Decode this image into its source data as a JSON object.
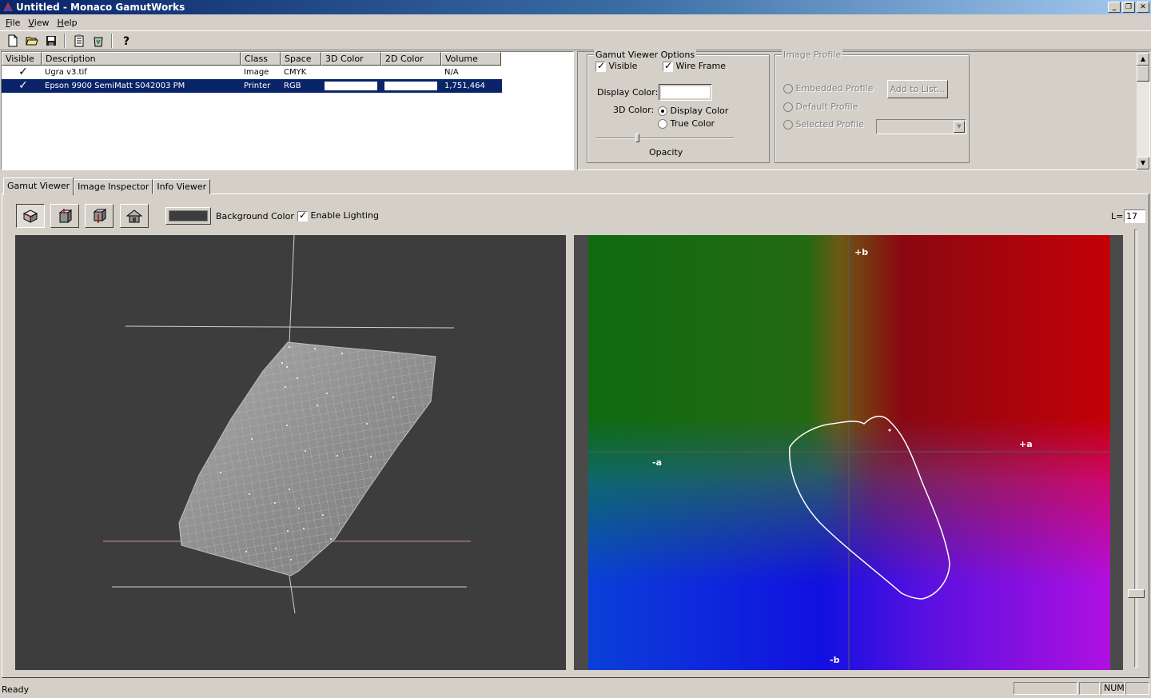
{
  "window": {
    "title": "Untitled - Monaco GamutWorks"
  },
  "menu": [
    {
      "underline": "F",
      "rest": "ile"
    },
    {
      "underline": "V",
      "rest": "iew"
    },
    {
      "underline": "H",
      "rest": "elp"
    }
  ],
  "list": {
    "columns": [
      "Visible",
      "Description",
      "Class",
      "Space",
      "3D Color",
      "2D Color",
      "Volume"
    ],
    "rows": [
      {
        "visible": "✓",
        "description": "Ugra v3.tif",
        "class": "Image",
        "space": "CMYK",
        "volume": "N/A",
        "selected": false
      },
      {
        "visible": "✓",
        "description": "Epson 9900 SemiMatt S042003 PM",
        "class": "Printer",
        "space": "RGB",
        "volume": "1,751,464",
        "selected": true
      }
    ]
  },
  "gamut_options": {
    "title": "Gamut Viewer Options",
    "visible_label": "Visible",
    "wireframe_label": "Wire Frame",
    "display_color_label": "Display Color:",
    "color3d_label": "3D Color:",
    "opt_display_color": "Display Color",
    "opt_true_color": "True Color",
    "opacity_label": "Opacity",
    "opacity": 0.3
  },
  "image_profile": {
    "title": "Image Profile",
    "embedded": "Embedded Profile",
    "default": "Default Profile",
    "selected": "Selected Profile",
    "add_button": "Add to List..."
  },
  "tabs": [
    "Gamut Viewer",
    "Image Inspector",
    "Info Viewer"
  ],
  "viewer": {
    "background_color_label": "Background Color",
    "lighting_label": "Enable Lighting",
    "background_color": "#3d3d3d",
    "l_label": "L=",
    "l_value": "17"
  },
  "plot2d": {
    "pos_b": "+b",
    "neg_b": "-b",
    "pos_a": "+a",
    "neg_a": "-a"
  },
  "status": {
    "text": "Ready",
    "num": "NUM"
  }
}
